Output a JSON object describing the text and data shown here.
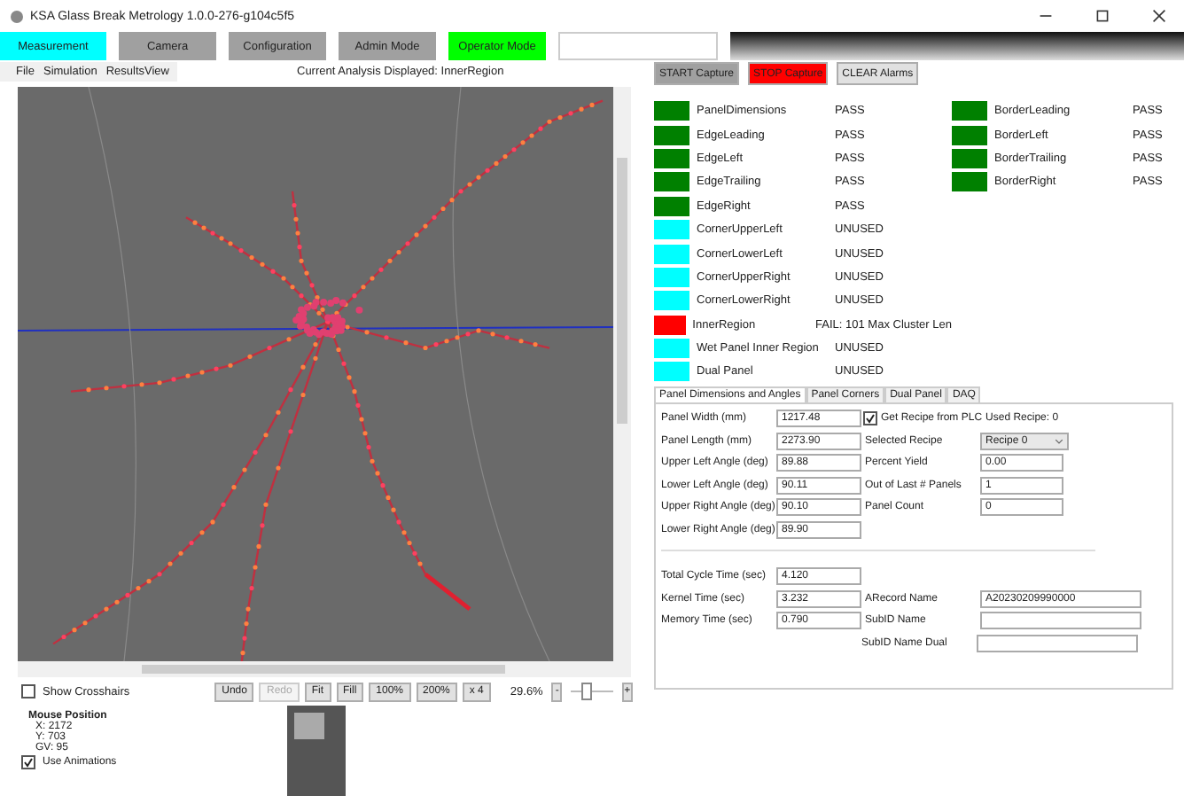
{
  "window": {
    "title": "KSA Glass Break Metrology 1.0.0-276-g104c5f5"
  },
  "tabs": [
    {
      "label": "Measurement",
      "selected": true,
      "color": "#00ffff"
    },
    {
      "label": "Camera",
      "selected": false,
      "color": "#a0a0a0"
    },
    {
      "label": "Configuration",
      "selected": false,
      "color": "#a0a0a0"
    },
    {
      "label": "Admin Mode",
      "selected": false,
      "color": "#a0a0a0"
    },
    {
      "label": "Operator Mode",
      "selected": false,
      "color": "#00ff00"
    }
  ],
  "menu": [
    "File",
    "Simulation",
    "ResultsView"
  ],
  "analysis": {
    "label": "Current Analysis Displayed:",
    "value": "InnerRegion"
  },
  "viewer": {
    "show_crosshairs": {
      "label": "Show Crosshairs",
      "checked": false
    },
    "buttons": [
      {
        "label": "Undo",
        "disabled": false
      },
      {
        "label": "Redo",
        "disabled": true
      },
      {
        "label": "Fit",
        "disabled": false
      },
      {
        "label": "Fill",
        "disabled": false
      },
      {
        "label": "100%",
        "disabled": false
      },
      {
        "label": "200%",
        "disabled": false
      },
      {
        "label": "x 4",
        "disabled": false
      }
    ],
    "zoom": "29.6%",
    "zoom_out": "-",
    "zoom_in": "+",
    "slider": {
      "level": 0.35
    },
    "mouse_position": {
      "title": "Mouse Position",
      "lines": [
        "X: 2172",
        "Y: 703",
        "GV: 95"
      ]
    },
    "use_animations": {
      "label": "Use Animations",
      "checked": true
    }
  },
  "capture_buttons": [
    {
      "label": "START Capture",
      "color": "#a0a0a0"
    },
    {
      "label": "STOP Capture",
      "color": "#ff0000"
    },
    {
      "label": "CLEAR Alarms",
      "color": "#e1e1e1"
    }
  ],
  "status_left": [
    {
      "name": "PanelDimensions",
      "result": "PASS",
      "color": "#008000"
    },
    {
      "name": "EdgeLeading",
      "result": "PASS",
      "color": "#008000"
    },
    {
      "name": "EdgeLeft",
      "result": "PASS",
      "color": "#008000"
    },
    {
      "name": "EdgeTrailing",
      "result": "PASS",
      "color": "#008000"
    },
    {
      "name": "EdgeRight",
      "result": "PASS",
      "color": "#008000"
    },
    {
      "name": "CornerUpperLeft",
      "result": "UNUSED",
      "color": "#00ffff"
    },
    {
      "name": "CornerLowerLeft",
      "result": "UNUSED",
      "color": "#00ffff"
    },
    {
      "name": "CornerUpperRight",
      "result": "UNUSED",
      "color": "#00ffff"
    },
    {
      "name": "CornerLowerRight",
      "result": "UNUSED",
      "color": "#00ffff"
    },
    {
      "name": "InnerRegion",
      "result": "FAIL: 101 Max Cluster Len",
      "color": "#ff0000"
    },
    {
      "name": "Wet Panel Inner Region",
      "result": "UNUSED",
      "color": "#00ffff"
    },
    {
      "name": "Dual Panel",
      "result": "UNUSED",
      "color": "#00ffff"
    }
  ],
  "status_right": [
    {
      "name": "BorderLeading",
      "result": "PASS",
      "color": "#008000"
    },
    {
      "name": "BorderLeft",
      "result": "PASS",
      "color": "#008000"
    },
    {
      "name": "BorderTrailing",
      "result": "PASS",
      "color": "#008000"
    },
    {
      "name": "BorderRight",
      "result": "PASS",
      "color": "#008000"
    }
  ],
  "form_tabs": [
    {
      "label": "Panel Dimensions and Angles",
      "selected": true
    },
    {
      "label": "Panel Corners",
      "selected": false
    },
    {
      "label": "Dual Panel",
      "selected": false
    },
    {
      "label": "DAQ",
      "selected": false
    }
  ],
  "form_sections": [
    [
      {
        "label": "Panel Width (mm)",
        "value": "1217.48",
        "right": {
          "kind": "checkbox",
          "label": "Get Recipe from PLC",
          "checked": true,
          "note": "Used Recipe: 0"
        }
      },
      {
        "label": "Panel Length (mm)",
        "value": "2273.90",
        "right": {
          "kind": "dropdown",
          "label": "Selected Recipe",
          "value": "Recipe 0"
        }
      },
      {
        "label": "Upper Left Angle (deg)",
        "value": "89.88",
        "right": {
          "kind": "input",
          "label": "Percent Yield",
          "value": "0.00"
        }
      },
      {
        "label": "Lower Left Angle (deg)",
        "value": "90.11",
        "right": {
          "kind": "input",
          "label": "Out of Last # Panels",
          "value": "1"
        }
      },
      {
        "label": "Upper Right Angle (deg)",
        "value": "90.10",
        "right": {
          "kind": "input",
          "label": "Panel Count",
          "value": "0"
        }
      },
      {
        "label": "Lower Right Angle (deg)",
        "value": "89.90"
      }
    ],
    [
      {
        "label": "Total Cycle Time (sec)",
        "value": "4.120"
      },
      {
        "label": "Kernel Time (sec)",
        "value": "3.232",
        "right": {
          "kind": "wide",
          "label": "ARecord Name",
          "value": "A20230209990000"
        }
      },
      {
        "label": "Memory Time (sec)",
        "value": "0.790",
        "right": {
          "kind": "wide",
          "label": "SubID Name"
        }
      },
      {
        "right": {
          "kind": "wide",
          "label": "SubID Name Dual"
        }
      }
    ]
  ]
}
